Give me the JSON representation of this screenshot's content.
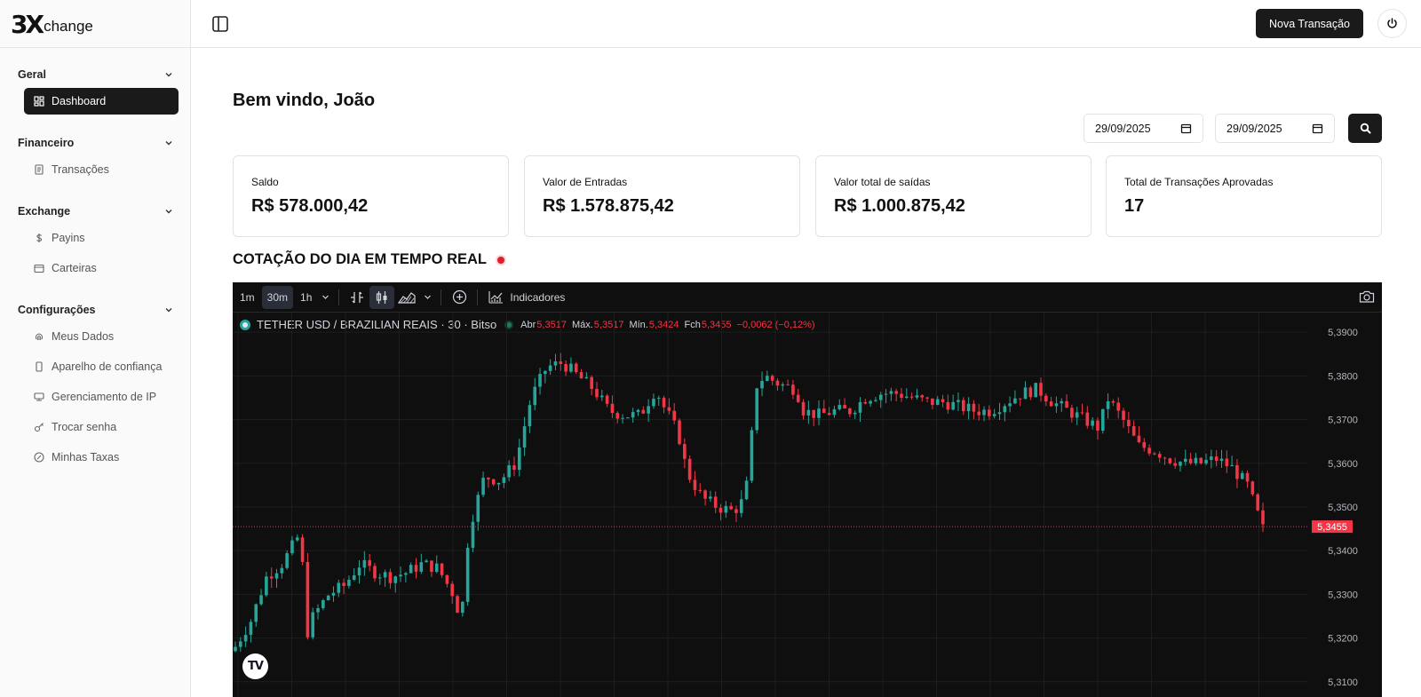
{
  "brand": {
    "mark": "3X",
    "text": "change"
  },
  "sidebar": {
    "groups": [
      {
        "label": "Geral",
        "items": [
          {
            "label": "Dashboard",
            "icon": "dashboard-icon",
            "active": true
          }
        ]
      },
      {
        "label": "Financeiro",
        "items": [
          {
            "label": "Transações",
            "icon": "receipt-icon"
          }
        ]
      },
      {
        "label": "Exchange",
        "items": [
          {
            "label": "Payins",
            "icon": "dollar-icon"
          },
          {
            "label": "Carteiras",
            "icon": "wallet-icon"
          }
        ]
      },
      {
        "label": "Configurações",
        "items": [
          {
            "label": "Meus Dados",
            "icon": "fingerprint-icon"
          },
          {
            "label": "Aparelho de confiança",
            "icon": "smartphone-icon"
          },
          {
            "label": "Gerenciamento de IP",
            "icon": "router-icon"
          },
          {
            "label": "Trocar senha",
            "icon": "key-icon"
          },
          {
            "label": "Minhas Taxas",
            "icon": "percent-icon"
          }
        ]
      }
    ]
  },
  "topbar": {
    "new_transaction_label": "Nova Transação"
  },
  "main": {
    "welcome": "Bem vindo, João",
    "date_from": "29/09/2025",
    "date_to": "29/09/2025",
    "cards": [
      {
        "label": "Saldo",
        "value": "R$ 578.000,42"
      },
      {
        "label": "Valor de Entradas",
        "value": "R$ 1.578.875,42"
      },
      {
        "label": "Valor total de saídas",
        "value": "R$ 1.000.875,42"
      },
      {
        "label": "Total de Transações Aprovadas",
        "value": "17"
      }
    ],
    "section_title": "COTAÇÃO DO DIA EM TEMPO REAL"
  },
  "tv": {
    "timeframes": [
      "1m",
      "30m",
      "1h"
    ],
    "active_timeframe": "30m",
    "indicators_label": "Indicadores",
    "symbol": "TETHER USD / BRAZILIAN REAIS · 30 · Bitso",
    "ohlc": {
      "open_label": "Abr",
      "open": "5,3517",
      "high_label": "Máx.",
      "high": "5,3517",
      "low_label": "Mín.",
      "low": "5,3424",
      "close_label": "Fch",
      "close": "5,3455",
      "change": "−0,0062 (−0,12%)"
    },
    "last_price_label": "5,3455",
    "logo": "TV"
  },
  "colors": {
    "up": "#26a69a",
    "down": "#f23645",
    "chart_bg": "#0f0f0f",
    "grid": "#1e1e1e",
    "accent_dark": "#1a1a1a"
  },
  "chart_data": {
    "type": "candlestick",
    "y_ticks": [
      "5,3900",
      "5,3800",
      "5,3700",
      "5,3600",
      "5,3500",
      "5,3400",
      "5,3300",
      "5,3200",
      "5,3100"
    ],
    "ylim": [
      5.3065,
      5.3945
    ],
    "last_price": 5.3455,
    "candles_count": 200,
    "close_path": [
      [
        0,
        5.318
      ],
      [
        4,
        5.324
      ],
      [
        8,
        5.334
      ],
      [
        12,
        5.337
      ],
      [
        16,
        5.343
      ],
      [
        17,
        5.342
      ],
      [
        18,
        5.32
      ],
      [
        20,
        5.325
      ],
      [
        24,
        5.33
      ],
      [
        28,
        5.332
      ],
      [
        32,
        5.337
      ],
      [
        36,
        5.335
      ],
      [
        40,
        5.334
      ],
      [
        44,
        5.335
      ],
      [
        48,
        5.337
      ],
      [
        52,
        5.336
      ],
      [
        56,
        5.33
      ],
      [
        58,
        5.324
      ],
      [
        60,
        5.345
      ],
      [
        64,
        5.357
      ],
      [
        68,
        5.356
      ],
      [
        72,
        5.36
      ],
      [
        76,
        5.375
      ],
      [
        80,
        5.382
      ],
      [
        84,
        5.383
      ],
      [
        88,
        5.38
      ],
      [
        92,
        5.377
      ],
      [
        96,
        5.372
      ],
      [
        100,
        5.371
      ],
      [
        104,
        5.371
      ],
      [
        108,
        5.377
      ],
      [
        110,
        5.373
      ],
      [
        112,
        5.37
      ],
      [
        114,
        5.366
      ],
      [
        116,
        5.358
      ],
      [
        120,
        5.352
      ],
      [
        124,
        5.35
      ],
      [
        128,
        5.349
      ],
      [
        131,
        5.352
      ],
      [
        134,
        5.378
      ],
      [
        136,
        5.38
      ],
      [
        140,
        5.378
      ],
      [
        144,
        5.377
      ],
      [
        146,
        5.372
      ],
      [
        150,
        5.371
      ],
      [
        154,
        5.372
      ],
      [
        158,
        5.372
      ],
      [
        162,
        5.375
      ],
      [
        166,
        5.376
      ],
      [
        170,
        5.376
      ],
      [
        174,
        5.375
      ],
      [
        178,
        5.374
      ],
      [
        182,
        5.374
      ],
      [
        186,
        5.373
      ],
      [
        190,
        5.372
      ],
      [
        194,
        5.372
      ],
      [
        198,
        5.374
      ],
      [
        202,
        5.376
      ],
      [
        206,
        5.377
      ],
      [
        210,
        5.374
      ],
      [
        214,
        5.372
      ],
      [
        218,
        5.37
      ],
      [
        222,
        5.368
      ],
      [
        224,
        5.375
      ],
      [
        228,
        5.37
      ],
      [
        232,
        5.364
      ],
      [
        236,
        5.363
      ],
      [
        240,
        5.361
      ],
      [
        244,
        5.36
      ],
      [
        248,
        5.36
      ],
      [
        252,
        5.361
      ],
      [
        256,
        5.359
      ],
      [
        260,
        5.355
      ],
      [
        262,
        5.35
      ],
      [
        264,
        5.345
      ]
    ]
  }
}
